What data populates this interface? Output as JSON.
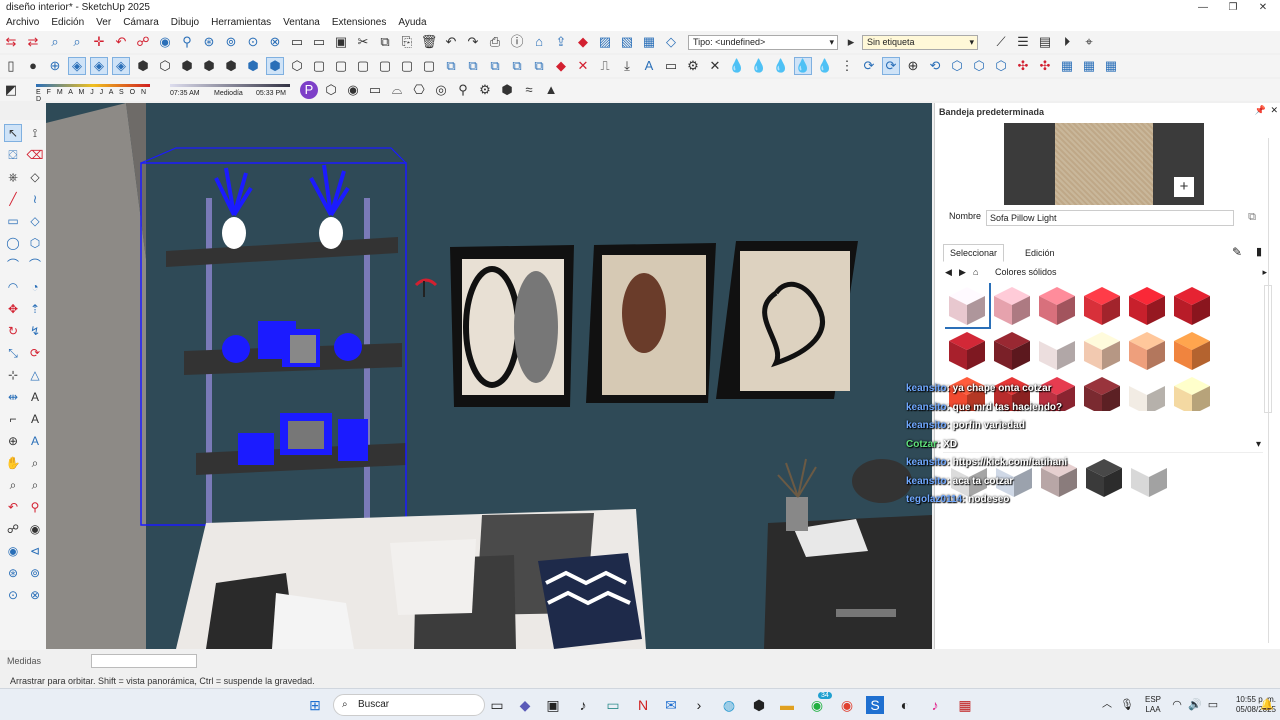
{
  "window": {
    "title": "diseño interior* - SketchUp 2025"
  },
  "menu": [
    "Archivo",
    "Edición",
    "Ver",
    "Cámara",
    "Dibujo",
    "Herramientas",
    "Ventana",
    "Extensiones",
    "Ayuda"
  ],
  "toolbar": {
    "tipo_label": "Tipo: <undefined>",
    "tag_label": "Sin etiqueta",
    "months": "E F M A M J J A S O N D",
    "time_start": "07:35 AM",
    "time_mid": "Mediodía",
    "time_end": "05:33 PM"
  },
  "tray": {
    "title": "Bandeja predeterminada",
    "name_label": "Nombre",
    "name_value": "Sofa Pillow Light",
    "tab_select": "Seleccionar",
    "tab_edit": "Edición",
    "collection": "Colores sólidos",
    "swatches": [
      "#e8c8cf",
      "#e6a2ad",
      "#d8707c",
      "#d8303a",
      "#c8202c",
      "#b81c28",
      "#a8202c",
      "#7a2028",
      "#ecdede",
      "#f2c9b0",
      "#ee9f7c",
      "#f0843e",
      "#f04a30",
      "#b82c2c",
      "#b83040",
      "#7a2a30",
      "#f2ece4",
      "#f4d9a2"
    ],
    "swatches2": [
      "#dcdcdc",
      "#cfd8e6",
      "#b8a6a6",
      "#3a3a3a",
      "#d8d8d8"
    ]
  },
  "chat": [
    {
      "user": "keansito",
      "text": ": ya chape onta cotzar"
    },
    {
      "user": "keansito",
      "text": ": que mrd tas haciendo?"
    },
    {
      "user": "keansito",
      "text": ": porfin variedad"
    },
    {
      "user": "Cotzar",
      "text": ": XD"
    },
    {
      "user": "keansito",
      "text": ": https://kick.com/tatihani"
    },
    {
      "user": "keansito",
      "text": ": aca ta cotzar"
    },
    {
      "user": "tegolaz0114",
      "text": ": nodeseo"
    }
  ],
  "measures": {
    "label": "Medidas"
  },
  "status": {
    "hint": "Arrastrar para orbitar. Shift = vista panorámica, Ctrl = suspende la gravedad."
  },
  "taskbar": {
    "search": "Buscar",
    "lang": "ESP",
    "lang2": "LAA",
    "time": "10:55 p. m.",
    "date": "05/08/2025",
    "badge": "34"
  }
}
